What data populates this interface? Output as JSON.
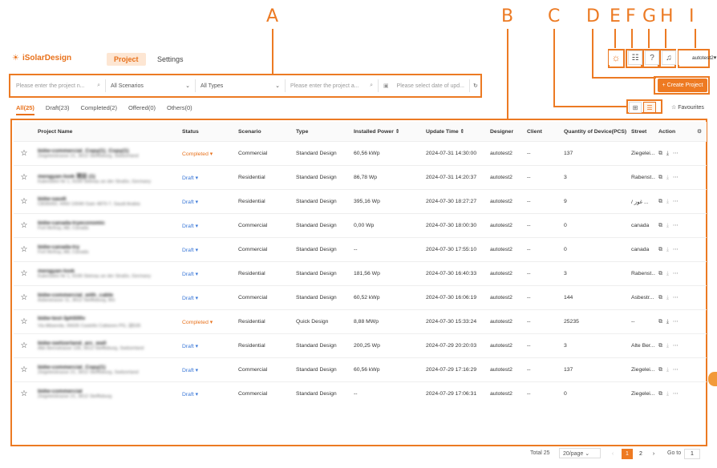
{
  "annotations": [
    "A",
    "B",
    "C",
    "D",
    "E",
    "F",
    "G",
    "H",
    "I"
  ],
  "app": {
    "name": "iSolarDesign"
  },
  "nav": {
    "project": "Project",
    "settings": "Settings"
  },
  "header": {
    "user": "autotest2"
  },
  "filters": {
    "project_name_placeholder": "Please enter the project n...",
    "scenarios": "All Scenarios",
    "types": "All Types",
    "project_address_placeholder": "Please enter the project a...",
    "date_placeholder": "Please select date of upd..."
  },
  "create_button": "+ Create Project",
  "tabs": [
    "All(25)",
    "Draft(23)",
    "Completed(2)",
    "Offered(0)",
    "Others(0)"
  ],
  "favourites": "Favourites",
  "columns": [
    "Project Name",
    "Status",
    "Scenario",
    "Type",
    "Installed Power ⇕",
    "Update Time ⇕",
    "Designer",
    "Client",
    "Quantity of Device(PCS)",
    "Street",
    "Action"
  ],
  "rows": [
    {
      "name": "bidw-commercial_Copy(1)_Copy(1)",
      "addr": "Ziegeleistrasse 21, 3612 Steffisburg, Switzerland",
      "status": "Completed ▾",
      "status_kind": "completed",
      "scenario": "Commercial",
      "type": "Standard Design",
      "power": "60,56 kWp",
      "time": "2024-07-31 14:30:00",
      "designer": "autotest2",
      "client": "--",
      "qty": "137",
      "street": "Ziegelei..."
    },
    {
      "name": "mengyan-look 项目 (1)",
      "addr": "Kalenstein Nr 1, 9199 Steinau an der Straße, Germany",
      "status": "Draft ▾",
      "status_kind": "draft",
      "scenario": "Residential",
      "type": "Standard Design",
      "power": "86,78 Wp",
      "time": "2024-07-31 14:20:37",
      "designer": "autotest2",
      "client": "--",
      "qty": "3",
      "street": "Rabenst..."
    },
    {
      "name": "bidw-saudi",
      "addr": "CB36050, 4450 10040 Gain 4870-7, Saudi Arabia",
      "status": "Draft ▾",
      "status_kind": "draft",
      "scenario": "Residential",
      "type": "Standard Design",
      "power": "395,16 Wp",
      "time": "2024-07-30 18:27:27",
      "designer": "autotest2",
      "client": "--",
      "qty": "9",
      "street": "/ غوز ..."
    },
    {
      "name": "bidw-canada-tryeconomic",
      "addr": "Fort McKay, AB, Canada",
      "status": "Draft ▾",
      "status_kind": "draft",
      "scenario": "Commercial",
      "type": "Standard Design",
      "power": "0,00 Wp",
      "time": "2024-07-30 18:00:30",
      "designer": "autotest2",
      "client": "--",
      "qty": "0",
      "street": "canada"
    },
    {
      "name": "bidw-canada-try",
      "addr": "Fort McKay, AB, Canada",
      "status": "Draft ▾",
      "status_kind": "draft",
      "scenario": "Commercial",
      "type": "Standard Design",
      "power": "--",
      "time": "2024-07-30 17:55:10",
      "designer": "autotest2",
      "client": "--",
      "qty": "0",
      "street": "canada"
    },
    {
      "name": "mengyan-look",
      "addr": "Kalenstein Nr 1, 9199 Steinau an der Straße, Germany",
      "status": "Draft ▾",
      "status_kind": "draft",
      "scenario": "Residential",
      "type": "Standard Design",
      "power": "181,56 Wp",
      "time": "2024-07-30 16:40:33",
      "designer": "autotest2",
      "client": "--",
      "qty": "3",
      "street": "Rabenst..."
    },
    {
      "name": "bidw-commercial_with_cable",
      "addr": "Asbestrasse 11, 3612 Steffisburg, BG",
      "status": "Draft ▾",
      "status_kind": "draft",
      "scenario": "Commercial",
      "type": "Standard Design",
      "power": "60,52 kWp",
      "time": "2024-07-30 16:06:19",
      "designer": "autotest2",
      "client": "--",
      "qty": "144",
      "street": "Asbestr..."
    },
    {
      "name": "bidw-test-3ph500v",
      "addr": "Via Albareda, 06635 Castello Cattaneo PG, 运535",
      "status": "Completed ▾",
      "status_kind": "completed",
      "scenario": "Residential",
      "type": "Quick Design",
      "power": "8,88 MWp",
      "time": "2024-07-30 15:33:24",
      "designer": "autotest2",
      "client": "--",
      "qty": "25235",
      "street": "--"
    },
    {
      "name": "bidw-switzerland_arc_wall",
      "addr": "Alte Bernstrasse 135, 3612 Steffisburg, Switzerland",
      "status": "Draft ▾",
      "status_kind": "draft",
      "scenario": "Residential",
      "type": "Standard Design",
      "power": "200,25 Wp",
      "time": "2024-07-29 20:20:03",
      "designer": "autotest2",
      "client": "--",
      "qty": "3",
      "street": "Alte Ber..."
    },
    {
      "name": "bidw-commercial_Copy(1)",
      "addr": "Ziegeleistrasse 21, 3612 Steffisburg, Switzerland",
      "status": "Draft ▾",
      "status_kind": "draft",
      "scenario": "Commercial",
      "type": "Standard Design",
      "power": "60,56 kWp",
      "time": "2024-07-29 17:16:29",
      "designer": "autotest2",
      "client": "--",
      "qty": "137",
      "street": "Ziegelei..."
    },
    {
      "name": "bidw-commercial",
      "addr": "Ziegeleistrasse 21, 3612 Steffisburg",
      "status": "Draft ▾",
      "status_kind": "draft",
      "scenario": "Commercial",
      "type": "Standard Design",
      "power": "--",
      "time": "2024-07-29 17:06:31",
      "designer": "autotest2",
      "client": "--",
      "qty": "0",
      "street": "Ziegelei..."
    }
  ],
  "pagination": {
    "total": "Total 25",
    "page_size": "20/page",
    "pages": [
      "1",
      "2"
    ],
    "goto_label": "Go to",
    "goto_value": "1"
  }
}
